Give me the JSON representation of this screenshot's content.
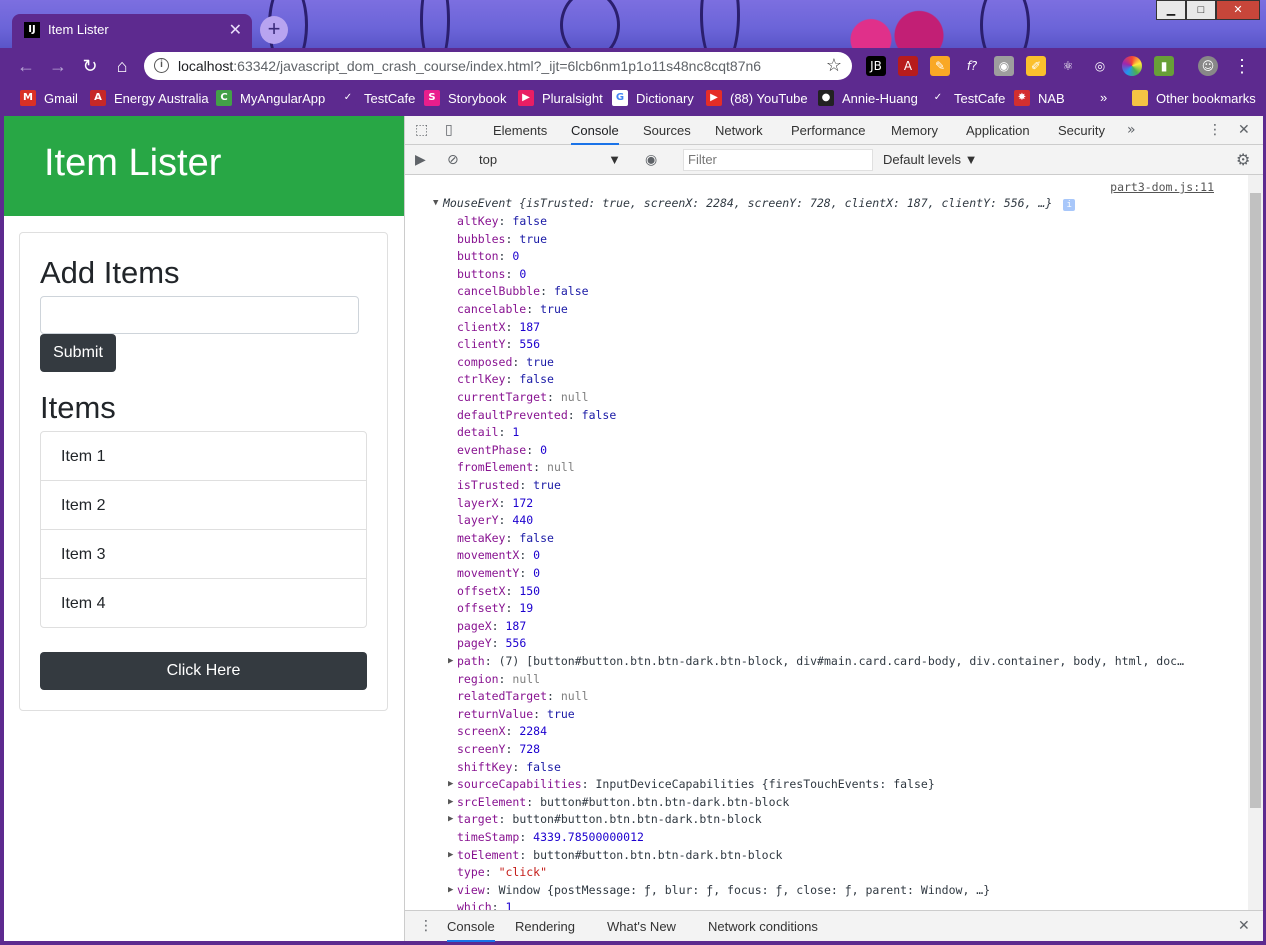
{
  "browser": {
    "tab_title": "Item Lister",
    "tab_favicon": "IJ",
    "url_host": "localhost",
    "url_rest": ":63342/javascript_dom_crash_course/index.html?_ijt=6lcb6nm1p1o11s48nc8cqt87n6",
    "bookmarks": [
      {
        "label": "Gmail",
        "icon": "M",
        "color": "#d93025"
      },
      {
        "label": "Energy Australia",
        "icon": "A",
        "color": "#c62828"
      },
      {
        "label": "MyAngularApp",
        "icon": "C",
        "color": "#43a047"
      },
      {
        "label": "TestCafe",
        "icon": "✓",
        "color": "#5d2a8f"
      },
      {
        "label": "Storybook",
        "icon": "S",
        "color": "#e91e8c"
      },
      {
        "label": "Pluralsight",
        "icon": "▶",
        "color": "#e91e63"
      },
      {
        "label": "Dictionary",
        "icon": "G",
        "color": "#ffffff"
      },
      {
        "label": "(88) YouTube",
        "icon": "▶",
        "color": "#e52d27"
      },
      {
        "label": "Annie-Huang",
        "icon": "●",
        "color": "#222222"
      },
      {
        "label": "TestCafe",
        "icon": "✓",
        "color": "#5d2a8f"
      },
      {
        "label": "NAB",
        "icon": "✸",
        "color": "#d32f2f"
      }
    ],
    "overflow": "»",
    "other_bookmarks": "Other bookmarks"
  },
  "page": {
    "header_title": "Item Lister",
    "add_heading": "Add Items",
    "submit_label": "Submit",
    "items_heading": "Items",
    "items": [
      "Item 1",
      "Item 2",
      "Item 3",
      "Item 4"
    ],
    "click_label": "Click Here"
  },
  "devtools": {
    "tabs": [
      "Elements",
      "Console",
      "Sources",
      "Network",
      "Performance",
      "Memory",
      "Application",
      "Security"
    ],
    "active_tab": "Console",
    "more": "»",
    "context": "top",
    "filter_placeholder": "Filter",
    "levels": "Default levels",
    "source_link": "part3-dom.js:11",
    "summary": "MouseEvent {isTrusted: true, screenX: 2284, screenY: 728, clientX: 187, clientY: 556, …}",
    "summary_info": "i",
    "props": [
      {
        "k": "altKey",
        "v": "false",
        "t": "v"
      },
      {
        "k": "bubbles",
        "v": "true",
        "t": "v"
      },
      {
        "k": "button",
        "v": "0",
        "t": "n"
      },
      {
        "k": "buttons",
        "v": "0",
        "t": "n"
      },
      {
        "k": "cancelBubble",
        "v": "false",
        "t": "v"
      },
      {
        "k": "cancelable",
        "v": "true",
        "t": "v"
      },
      {
        "k": "clientX",
        "v": "187",
        "t": "n"
      },
      {
        "k": "clientY",
        "v": "556",
        "t": "n"
      },
      {
        "k": "composed",
        "v": "true",
        "t": "v"
      },
      {
        "k": "ctrlKey",
        "v": "false",
        "t": "v"
      },
      {
        "k": "currentTarget",
        "v": "null",
        "t": "nl"
      },
      {
        "k": "defaultPrevented",
        "v": "false",
        "t": "v"
      },
      {
        "k": "detail",
        "v": "1",
        "t": "n"
      },
      {
        "k": "eventPhase",
        "v": "0",
        "t": "n"
      },
      {
        "k": "fromElement",
        "v": "null",
        "t": "nl"
      },
      {
        "k": "isTrusted",
        "v": "true",
        "t": "v"
      },
      {
        "k": "layerX",
        "v": "172",
        "t": "n"
      },
      {
        "k": "layerY",
        "v": "440",
        "t": "n"
      },
      {
        "k": "metaKey",
        "v": "false",
        "t": "v"
      },
      {
        "k": "movementX",
        "v": "0",
        "t": "n"
      },
      {
        "k": "movementY",
        "v": "0",
        "t": "n"
      },
      {
        "k": "offsetX",
        "v": "150",
        "t": "n"
      },
      {
        "k": "offsetY",
        "v": "19",
        "t": "n"
      },
      {
        "k": "pageX",
        "v": "187",
        "t": "n"
      },
      {
        "k": "pageY",
        "v": "556",
        "t": "n"
      },
      {
        "k": "path",
        "v": "(7) [button#button.btn.btn-dark.btn-block, div#main.card.card-body, div.container, body, html, doc…",
        "t": "o",
        "expand": true
      },
      {
        "k": "region",
        "v": "null",
        "t": "nl"
      },
      {
        "k": "relatedTarget",
        "v": "null",
        "t": "nl"
      },
      {
        "k": "returnValue",
        "v": "true",
        "t": "v"
      },
      {
        "k": "screenX",
        "v": "2284",
        "t": "n"
      },
      {
        "k": "screenY",
        "v": "728",
        "t": "n"
      },
      {
        "k": "shiftKey",
        "v": "false",
        "t": "v"
      },
      {
        "k": "sourceCapabilities",
        "v": "InputDeviceCapabilities {firesTouchEvents: false}",
        "t": "o",
        "expand": true
      },
      {
        "k": "srcElement",
        "v": "button#button.btn.btn-dark.btn-block",
        "t": "o",
        "expand": true
      },
      {
        "k": "target",
        "v": "button#button.btn.btn-dark.btn-block",
        "t": "o",
        "expand": true
      },
      {
        "k": "timeStamp",
        "v": "4339.78500000012",
        "t": "n"
      },
      {
        "k": "toElement",
        "v": "button#button.btn.btn-dark.btn-block",
        "t": "o",
        "expand": true
      },
      {
        "k": "type",
        "v": "\"click\"",
        "t": "s"
      },
      {
        "k": "view",
        "v": "Window {postMessage: ƒ, blur: ƒ, focus: ƒ, close: ƒ, parent: Window, …}",
        "t": "o",
        "expand": true
      },
      {
        "k": "which",
        "v": "1",
        "t": "n"
      }
    ],
    "drawer_tabs": [
      "Console",
      "Rendering",
      "What's New",
      "Network conditions"
    ],
    "drawer_active": "Console"
  },
  "colors": {
    "header_green": "#28a745",
    "dark_button": "#343a40",
    "chrome_purple": "#5d2a8f"
  }
}
